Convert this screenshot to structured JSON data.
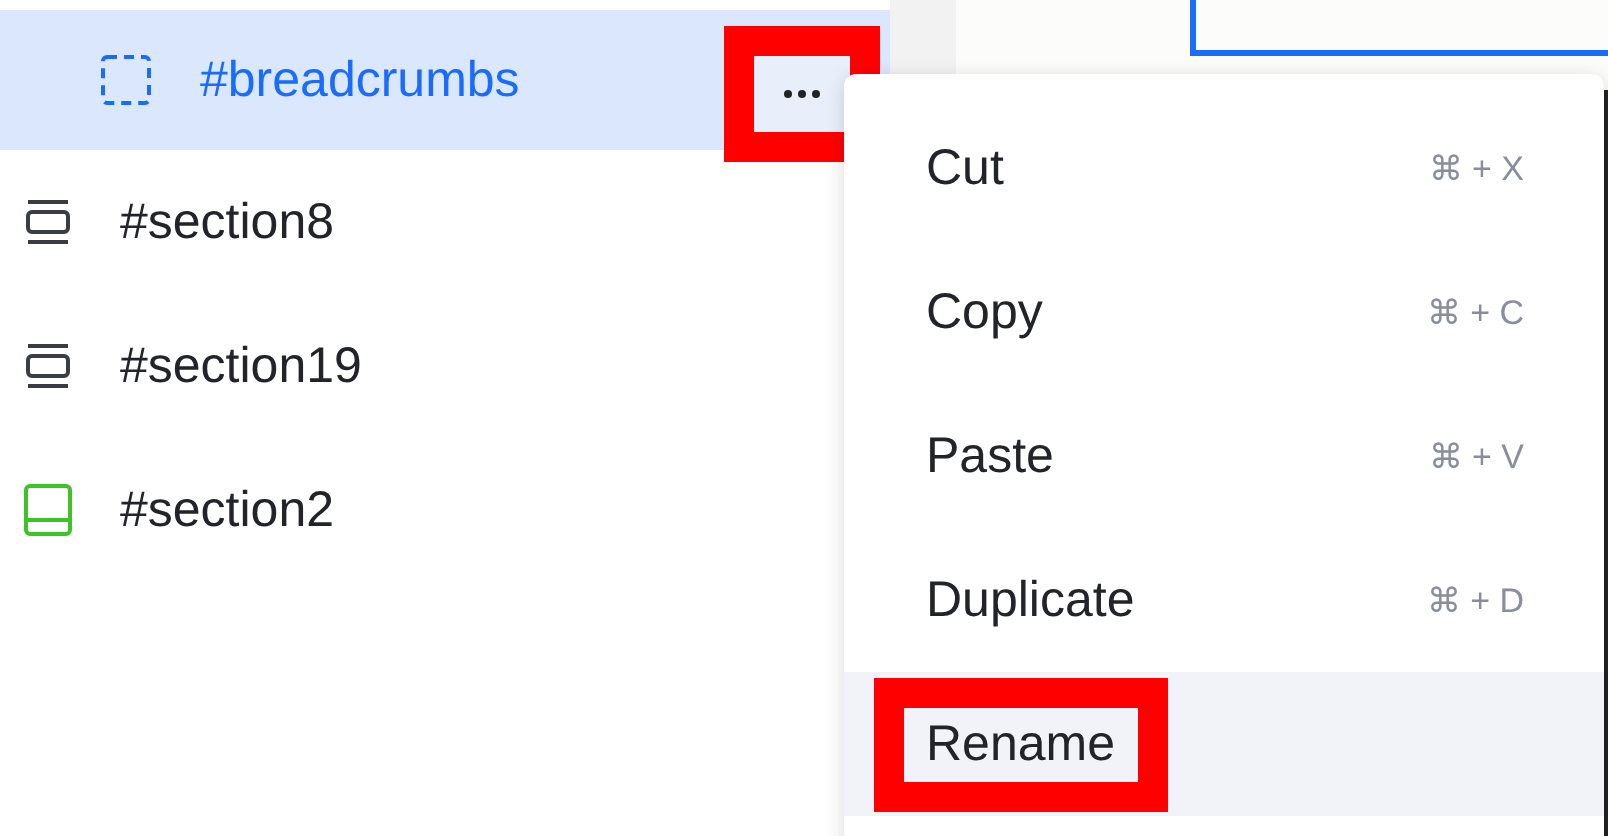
{
  "layers": [
    {
      "children": [
        {
          "label": "#breadcrumbs",
          "kind": "container",
          "selected": true,
          "annotated": true
        }
      ]
    },
    {
      "label": "#section8",
      "kind": "section",
      "selected": false
    },
    {
      "label": "#section19",
      "kind": "section",
      "selected": false
    },
    {
      "label": "#section2",
      "kind": "footer",
      "selected": false
    }
  ],
  "context_menu": {
    "items": [
      {
        "label": "Cut",
        "shortcut": "⌘ + X",
        "selected": false,
        "annotated": false
      },
      {
        "label": "Copy",
        "shortcut": "⌘ + C",
        "selected": false,
        "annotated": false
      },
      {
        "label": "Paste",
        "shortcut": "⌘ + V",
        "selected": false,
        "annotated": false
      },
      {
        "label": "Duplicate",
        "shortcut": "⌘ + D",
        "selected": false,
        "annotated": false
      },
      {
        "label": "Rename",
        "selected": true,
        "annotated": true
      }
    ]
  }
}
